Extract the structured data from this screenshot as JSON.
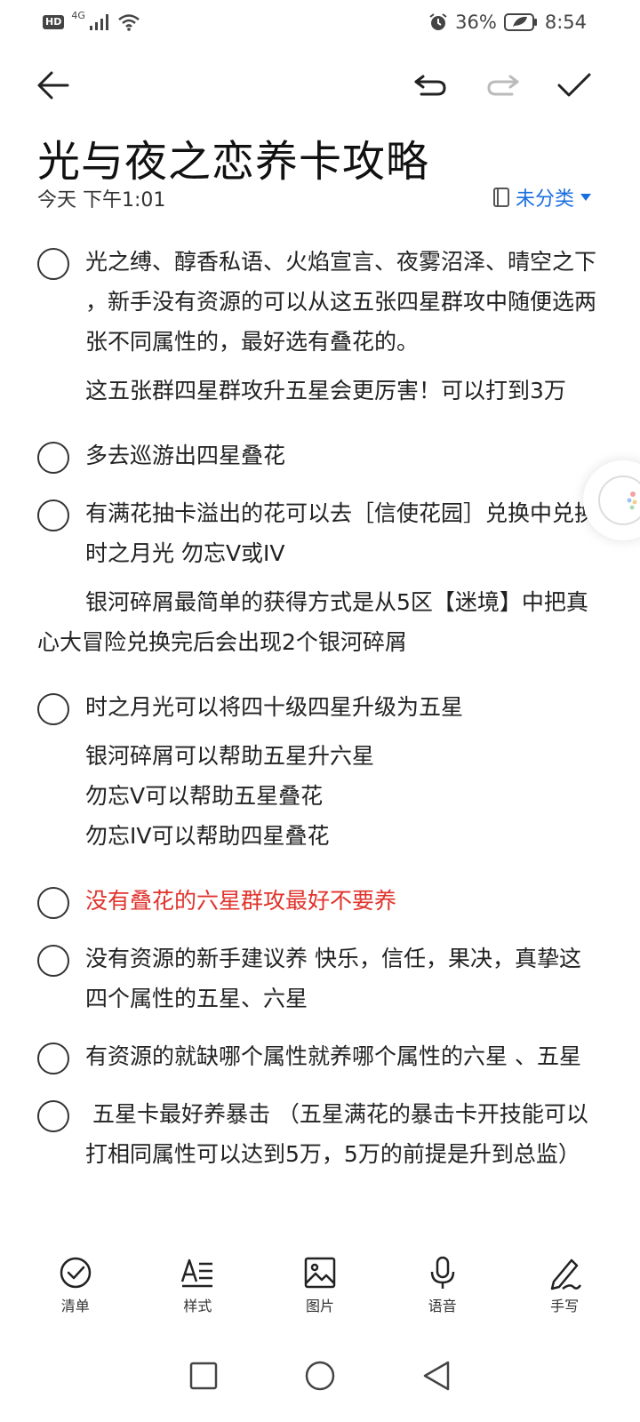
{
  "status_bar": {
    "hd": "HD",
    "network": "4G",
    "battery": "36%",
    "time": "8:54",
    "icons": [
      "signal-icon",
      "wifi-icon",
      "alarm-icon",
      "battery-icon"
    ]
  },
  "toolbar": {
    "icons": [
      "back-arrow-icon",
      "undo-icon",
      "redo-icon",
      "check-icon"
    ]
  },
  "note": {
    "title": "光与夜之恋养卡攻略",
    "date": "今天 下午1:01",
    "category": "未分类"
  },
  "content": {
    "item1": "光之缚、醇香私语、火焰宣言、夜雾沼泽、晴空之下 ，新手没有资源的可以从这五张四星群攻中随便选两张不同属性的，最好选有叠花的。",
    "para1": "这五张群四星群攻升五星会更厉害！可以打到3万",
    "item2": "多去巡游出四星叠花",
    "item3": "有满花抽卡溢出的花可以去［信使花园］兑换中兑换时之月光 勿忘V或IV",
    "para2": "银河碎屑最简单的获得方式是从5区【迷境】中把真心大冒险兑换完后会出现2个银河碎屑",
    "item4": "时之月光可以将四十级四星升级为五星",
    "para3": "银河碎屑可以帮助五星升六星",
    "para4": "勿忘V可以帮助五星叠花",
    "para5": "勿忘IV可以帮助四星叠花",
    "item5": "没有叠花的六星群攻最好不要养",
    "item6": "没有资源的新手建议养 快乐，信任，果决，真挚这四个属性的五星、六星",
    "item7": "有资源的就缺哪个属性就养哪个属性的六星 、五星",
    "item8": " 五星卡最好养暴击 （五星满花的暴击卡开技能可以打相同属性可以达到5万，5万的前提是升到总监）"
  },
  "bottom_tools": {
    "checklist": "清单",
    "style": "样式",
    "image": "图片",
    "voice": "语音",
    "handwrite": "手写"
  },
  "colors": {
    "accent": "#1a6fe0",
    "highlight_red": "#e0332c"
  }
}
